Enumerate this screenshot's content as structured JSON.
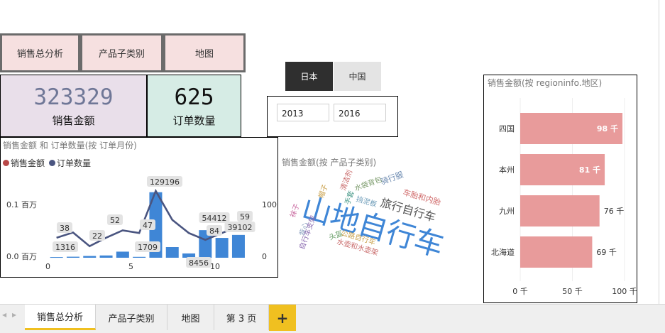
{
  "nav": {
    "buttons": [
      "销售总分析",
      "产品子类别",
      "地图"
    ]
  },
  "kpis": {
    "sales": {
      "value": "323329",
      "label": "销售金额",
      "color": "#6f7797",
      "bg": "#e9dfea"
    },
    "orders": {
      "value": "625",
      "label": "订单数量",
      "color": "#111111",
      "bg": "#d6ece5"
    }
  },
  "region_tabs": {
    "items": [
      "日本",
      "中国"
    ],
    "selected": "日本"
  },
  "year_filter": {
    "from": "2013",
    "to": "2016"
  },
  "combo_chart": {
    "title": "销售金额 和 订单数量(按 订单月份)",
    "legend": [
      {
        "name": "销售金额",
        "color": "#b84848"
      },
      {
        "name": "订单数量",
        "color": "#4a5580"
      }
    ],
    "y_left_ticks": [
      "0.1 百万",
      "0.0 百万"
    ],
    "y_right_ticks": [
      "100",
      "0"
    ],
    "x_ticks": [
      "0",
      "5",
      "10"
    ],
    "labels": [
      "1316",
      "38",
      "22",
      "52",
      "1709",
      "47",
      "129196",
      "8456",
      "54412",
      "84",
      "59",
      "39102"
    ]
  },
  "chart_data": [
    {
      "type": "bar",
      "title": "销售金额 和 订单数量(按 订单月份)",
      "x": [
        1,
        2,
        3,
        4,
        5,
        6,
        7,
        8,
        9,
        10,
        11,
        12
      ],
      "series": [
        {
          "name": "销售金额",
          "type": "bar",
          "values": [
            1316,
            2000,
            3500,
            4500,
            12000,
            1709,
            129196,
            21000,
            8456,
            54412,
            39102,
            45000
          ],
          "color": "#3f86d6"
        },
        {
          "name": "订单数量",
          "type": "line",
          "values": [
            38,
            48,
            22,
            38,
            52,
            47,
            127,
            72,
            47,
            34,
            47,
            59
          ],
          "color": "#4a5580"
        }
      ],
      "ylim_left": [
        0,
        140000
      ],
      "ylim_right": [
        0,
        135
      ],
      "ylabel": "",
      "xlabel": ""
    },
    {
      "type": "bar",
      "orientation": "horizontal",
      "title": "销售金额(按 regioninfo.地区)",
      "categories": [
        "四国",
        "本州",
        "九州",
        "北海道"
      ],
      "values": [
        98,
        81,
        76,
        69
      ],
      "value_labels": [
        "98 千",
        "81 千",
        "76 千",
        "69 千"
      ],
      "x_ticks": [
        "0 千",
        "50 千",
        "100 千"
      ],
      "xlim": [
        0,
        100
      ],
      "color": "#e89b9b"
    }
  ],
  "wordcloud": {
    "title": "销售金额(按 产品子类别)",
    "words": [
      {
        "text": "山地自行车",
        "color": "#3f86d6"
      },
      {
        "text": "旅行自行车",
        "color": "#555555"
      },
      {
        "text": "车胎和内胎",
        "color": "#d06a6a"
      },
      {
        "text": "骑行服",
        "color": "#6b89b0"
      },
      {
        "text": "水袋背包",
        "color": "#7a9a6a"
      },
      {
        "text": "挡泥板",
        "color": "#6b9bb8"
      },
      {
        "text": "手套",
        "color": "#4a9a8a"
      },
      {
        "text": "清洁剂",
        "color": "#c96a6a"
      },
      {
        "text": "帽子",
        "color": "#c9a04a"
      },
      {
        "text": "袜子",
        "color": "#c96aa0"
      },
      {
        "text": "背心",
        "color": "#8aa0c0"
      },
      {
        "text": "头盔",
        "color": "#6aa06a"
      },
      {
        "text": "公路自行车",
        "color": "#c9a04a"
      },
      {
        "text": "水壶和水壶架",
        "color": "#c96a6a"
      },
      {
        "text": "自行车支架",
        "color": "#8a6ab0"
      }
    ]
  },
  "page_tabs": {
    "items": [
      "销售总分析",
      "产品子类别",
      "地图",
      "第 3 页"
    ],
    "active": "销售总分析",
    "add_label": "+",
    "accent": "#f0c020"
  }
}
